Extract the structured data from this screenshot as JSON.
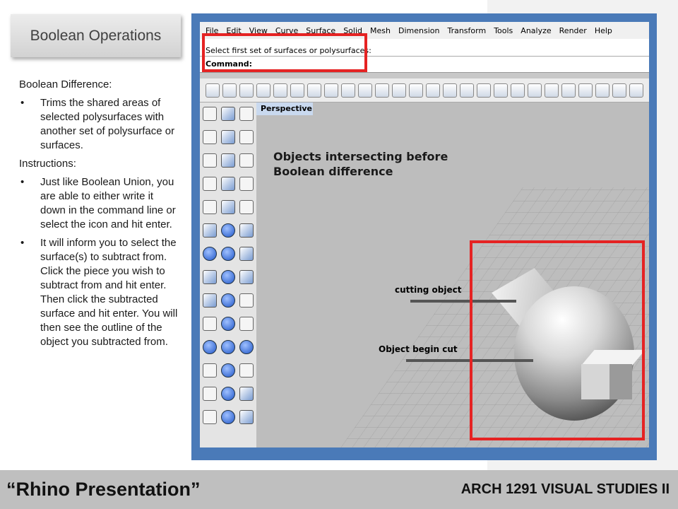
{
  "slide": {
    "title": "Boolean Operations",
    "section1_heading": "Boolean Difference:",
    "section1_bullets": [
      "Trims the shared areas of selected polysurfaces with another set of polysurface or surfaces."
    ],
    "section2_heading": "Instructions:",
    "section2_bullets": [
      "Just like Boolean Union, you are able to either write it down in the command line or select the icon and hit enter.",
      "It will inform you to select the surface(s) to subtract from. Click the piece you wish to subtract from and hit enter. Then click the subtracted surface and hit enter. You will then see the outline of the object you subtracted from."
    ],
    "bullet_glyph": "•"
  },
  "rhino": {
    "menu": [
      "File",
      "Edit",
      "View",
      "Curve",
      "Surface",
      "Solid",
      "Mesh",
      "Dimension",
      "Transform",
      "Tools",
      "Analyze",
      "Render",
      "Help"
    ],
    "command_prompt": "Select first set of surfaces or polysurfaces:",
    "command_label": "Command:",
    "viewport_tab": "Perspective",
    "viewport_caption_line1": "Objects intersecting before",
    "viewport_caption_line2": "Boolean difference",
    "annotation_cutting": "cutting object",
    "annotation_begin_cut": "Object begin cut"
  },
  "footer": {
    "left": "“Rhino Presentation”",
    "right": "ARCH 1291 VISUAL STUDIES II"
  },
  "colors": {
    "highlight_red": "#e52323",
    "frame_blue": "#4a7ab8",
    "footer_gray": "#bfbfbf"
  }
}
